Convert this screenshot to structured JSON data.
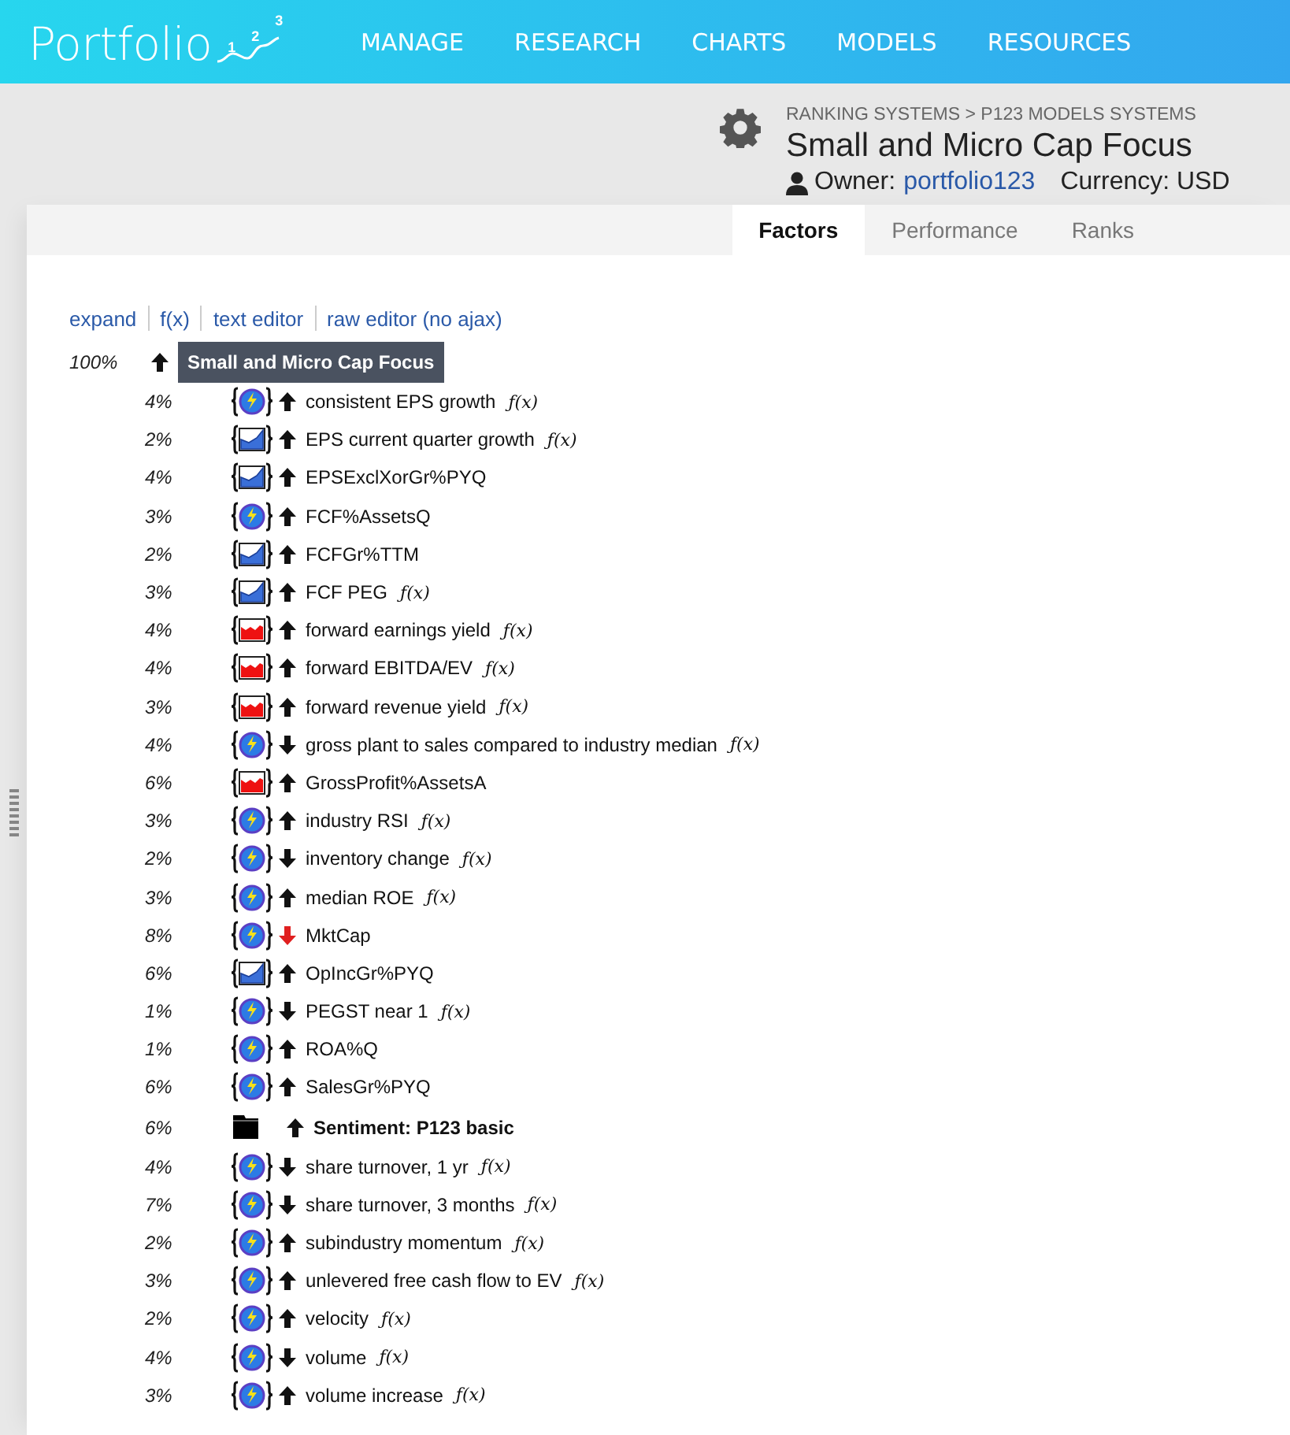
{
  "header": {
    "logo": "Portfolio",
    "logo_marks": [
      "1",
      "2",
      "3"
    ],
    "nav": [
      "MANAGE",
      "RESEARCH",
      "CHARTS",
      "MODELS",
      "RESOURCES"
    ]
  },
  "info": {
    "breadcrumb": "RANKING SYSTEMS > P123 MODELS SYSTEMS",
    "title": "Small and Micro Cap Focus",
    "owner_label": "Owner:",
    "owner": "portfolio123",
    "currency": "Currency: USD"
  },
  "tabs": [
    {
      "label": "Factors",
      "selected": true
    },
    {
      "label": "Performance",
      "selected": false
    },
    {
      "label": "Ranks",
      "selected": false
    }
  ],
  "links": [
    "expand",
    "f(x)",
    "text editor",
    "raw editor (no ajax)"
  ],
  "root": {
    "weight": "100%",
    "descending": false,
    "name": "Small and Micro Cap Focus"
  },
  "factors": [
    {
      "weight": "4%",
      "kind": "globe",
      "descending": false,
      "red": false,
      "name": "consistent EPS growth",
      "fx": "ƒ(x)"
    },
    {
      "weight": "2%",
      "kind": "chart-blue",
      "descending": false,
      "red": false,
      "name": "EPS current quarter growth",
      "fx": "ƒ(x)"
    },
    {
      "weight": "4%",
      "kind": "chart-blue",
      "descending": false,
      "red": false,
      "name": "EPSExclXorGr%PYQ"
    },
    {
      "weight": "3%",
      "kind": "globe",
      "descending": false,
      "red": false,
      "name": "FCF%AssetsQ"
    },
    {
      "weight": "2%",
      "kind": "chart-blue",
      "descending": false,
      "red": false,
      "name": "FCFGr%TTM"
    },
    {
      "weight": "3%",
      "kind": "chart-blue",
      "descending": false,
      "red": false,
      "name": "FCF PEG",
      "fx": "ƒ(x)"
    },
    {
      "weight": "4%",
      "kind": "chart-red",
      "descending": false,
      "red": false,
      "name": "forward earnings yield",
      "fx": "ƒ(x)"
    },
    {
      "weight": "4%",
      "kind": "chart-red",
      "descending": false,
      "red": false,
      "name": "forward EBITDA/EV",
      "fx": "ƒ(x)"
    },
    {
      "weight": "3%",
      "kind": "chart-red",
      "descending": false,
      "red": false,
      "name": "forward revenue yield",
      "fx": "ƒ(x)"
    },
    {
      "weight": "4%",
      "kind": "globe",
      "descending": true,
      "red": false,
      "name": "gross plant to sales compared to industry median",
      "fx": "ƒ(x)"
    },
    {
      "weight": "6%",
      "kind": "chart-red",
      "descending": false,
      "red": false,
      "name": "GrossProfit%AssetsA"
    },
    {
      "weight": "3%",
      "kind": "globe",
      "descending": false,
      "red": false,
      "name": "industry RSI",
      "fx": "ƒ(x)"
    },
    {
      "weight": "2%",
      "kind": "globe",
      "descending": true,
      "red": false,
      "name": "inventory change",
      "fx": "ƒ(x)"
    },
    {
      "weight": "3%",
      "kind": "globe",
      "descending": false,
      "red": false,
      "name": "median ROE",
      "fx": "ƒ(x)"
    },
    {
      "weight": "8%",
      "kind": "globe",
      "descending": true,
      "red": true,
      "name": "MktCap"
    },
    {
      "weight": "6%",
      "kind": "chart-blue",
      "descending": false,
      "red": false,
      "name": "OpIncGr%PYQ"
    },
    {
      "weight": "1%",
      "kind": "globe",
      "descending": true,
      "red": false,
      "name": "PEGST near 1",
      "fx": "ƒ(x)"
    },
    {
      "weight": "1%",
      "kind": "globe",
      "descending": false,
      "red": false,
      "name": "ROA%Q"
    },
    {
      "weight": "6%",
      "kind": "globe",
      "descending": false,
      "red": false,
      "name": "SalesGr%PYQ"
    },
    {
      "weight": "6%",
      "kind": "folder",
      "descending": false,
      "red": false,
      "name": "Sentiment: P123 basic"
    },
    {
      "weight": "4%",
      "kind": "globe",
      "descending": true,
      "red": false,
      "name": "share turnover, 1 yr",
      "fx": "ƒ(x)"
    },
    {
      "weight": "7%",
      "kind": "globe",
      "descending": true,
      "red": false,
      "name": "share turnover, 3 months",
      "fx": "ƒ(x)"
    },
    {
      "weight": "2%",
      "kind": "globe",
      "descending": false,
      "red": false,
      "name": "subindustry momentum",
      "fx": "ƒ(x)"
    },
    {
      "weight": "3%",
      "kind": "globe",
      "descending": false,
      "red": false,
      "name": "unlevered free cash flow to EV",
      "fx": "ƒ(x)"
    },
    {
      "weight": "2%",
      "kind": "globe",
      "descending": false,
      "red": false,
      "name": "velocity",
      "fx": "ƒ(x)"
    },
    {
      "weight": "4%",
      "kind": "globe",
      "descending": true,
      "red": false,
      "name": "volume",
      "fx": "ƒ(x)"
    },
    {
      "weight": "3%",
      "kind": "globe",
      "descending": false,
      "red": false,
      "name": "volume increase",
      "fx": "ƒ(x)"
    }
  ]
}
